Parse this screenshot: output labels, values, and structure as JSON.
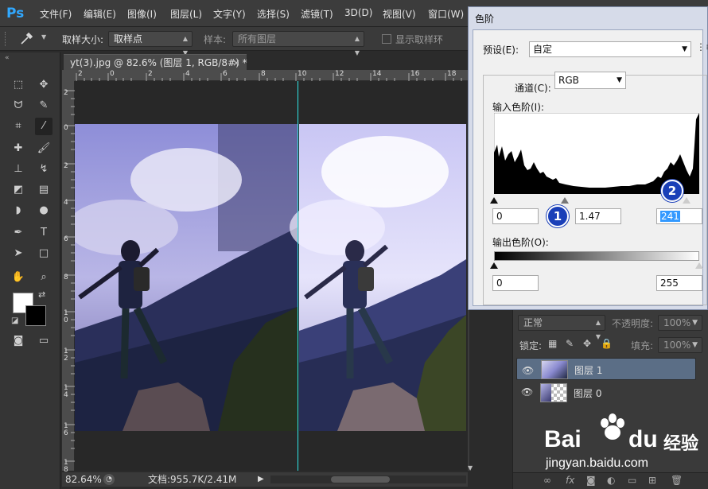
{
  "app": {
    "logo": "Ps"
  },
  "menu": [
    "文件(F)",
    "编辑(E)",
    "图像(I)",
    "图层(L)",
    "文字(Y)",
    "选择(S)",
    "滤镜(T)",
    "3D(D)",
    "视图(V)",
    "窗口(W)"
  ],
  "options": {
    "sample_size_label": "取样大小:",
    "sample_size_value": "取样点",
    "sample_label": "样本:",
    "sample_value": "所有图层",
    "show_ring_label": "显示取样环"
  },
  "document": {
    "tab_title": "yt(3).jpg @ 82.6% (图层 1, RGB/8#) *",
    "close_glyph": "×",
    "ruler_h_ticks": [
      "2",
      "0",
      "2",
      "4",
      "6",
      "8",
      "10",
      "12",
      "14",
      "16",
      "18",
      "20"
    ],
    "ruler_v_ticks": [
      "2",
      "0",
      "2",
      "4",
      "6",
      "8",
      "1\n0",
      "1\n2",
      "1\n4",
      "1\n6",
      "1\n8"
    ],
    "zoom": "82.64%",
    "doc_info": "文档:955.7K/2.41M"
  },
  "levels": {
    "title": "色阶",
    "preset_label": "预设(E):",
    "preset_value": "自定",
    "channel_label": "通道(C):",
    "channel_value": "RGB",
    "input_label": "输入色阶(I):",
    "input_black": "0",
    "input_gamma": "1.47",
    "input_white": "241",
    "output_label": "输出色阶(O):",
    "output_black": "0",
    "output_white": "255",
    "badge1": "1",
    "badge2": "2"
  },
  "layers": {
    "blend_mode": "正常",
    "opacity_label": "不透明度:",
    "opacity_value": "100%",
    "lock_label": "锁定:",
    "fill_label": "填充:",
    "fill_value": "100%",
    "items": [
      {
        "name": "图层 1",
        "selected": true
      },
      {
        "name": "图层 0",
        "selected": false
      }
    ]
  },
  "watermark": {
    "brand": "Bai",
    "brand2": "du",
    "brand_cn": "经验",
    "url": "jingyan.baidu.com"
  }
}
